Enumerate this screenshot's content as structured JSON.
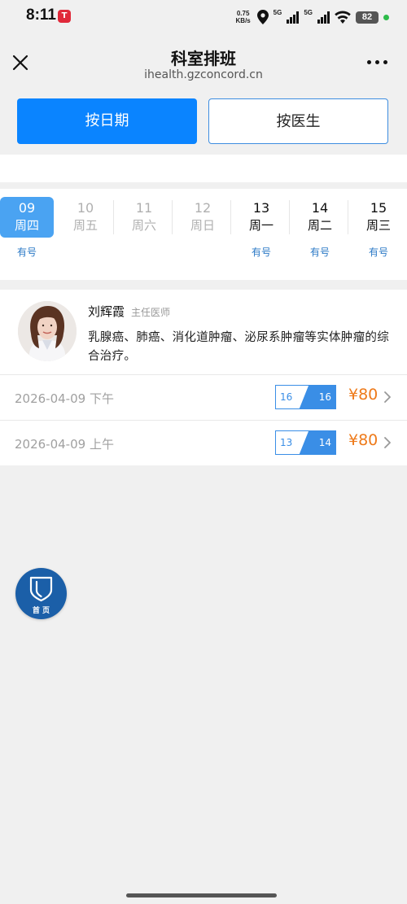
{
  "status_bar": {
    "time": "8:11",
    "app_icon": "T",
    "net_speed_value": "0.75",
    "net_speed_unit": "KB/s",
    "sim1": "5G",
    "sim2": "5G",
    "battery": "82"
  },
  "navbar": {
    "title": "科室排班",
    "url": "ihealth.gzconcord.cn"
  },
  "tabs": {
    "by_date": "按日期",
    "by_doctor": "按医生",
    "active": "by_date"
  },
  "dates": [
    {
      "day": "09",
      "weekday": "周四",
      "status": "有号",
      "state": "selected"
    },
    {
      "day": "10",
      "weekday": "周五",
      "status": "",
      "state": "disabled"
    },
    {
      "day": "11",
      "weekday": "周六",
      "status": "",
      "state": "disabled"
    },
    {
      "day": "12",
      "weekday": "周日",
      "status": "",
      "state": "disabled"
    },
    {
      "day": "13",
      "weekday": "周一",
      "status": "有号",
      "state": "active"
    },
    {
      "day": "14",
      "weekday": "周二",
      "status": "有号",
      "state": "active"
    },
    {
      "day": "15",
      "weekday": "周三",
      "status": "有号",
      "state": "active"
    }
  ],
  "doctor": {
    "name": "刘辉霞",
    "title": "主任医师",
    "description": "乳腺癌、肺癌、消化道肿瘤、泌尿系肿瘤等实体肿瘤的综合治疗。",
    "slots": [
      {
        "datetime": "2026-04-09 下午",
        "remaining": "16",
        "total": "16",
        "price": "¥80"
      },
      {
        "datetime": "2026-04-09 上午",
        "remaining": "13",
        "total": "14",
        "price": "¥80"
      }
    ]
  },
  "home_button": {
    "label": "首 页"
  },
  "colors": {
    "primary": "#0a84ff",
    "selected_date": "#4aa3f2",
    "status_blue": "#2b79c6",
    "price_orange": "#ee7a1a",
    "home_fab": "#1b5fa8"
  }
}
